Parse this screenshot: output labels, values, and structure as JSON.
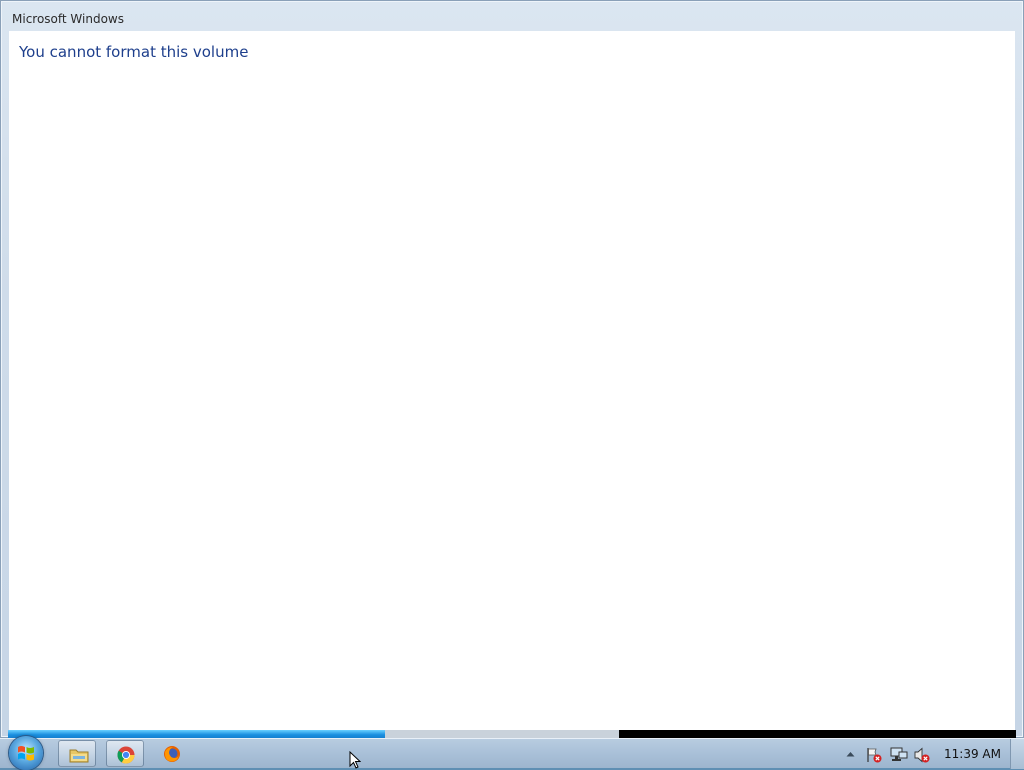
{
  "window": {
    "title": "Microsoft Windows",
    "message": "You cannot format this volume"
  },
  "progress": {
    "fill_fraction": 0.374,
    "track_fraction": 0.606
  },
  "taskbar": {
    "start_icon": "windows-start-orb",
    "pinned": [
      {
        "name": "file-explorer",
        "icon": "folder-icon"
      },
      {
        "name": "google-chrome",
        "icon": "chrome-icon"
      },
      {
        "name": "firefox",
        "icon": "firefox-icon"
      }
    ],
    "tray_icons": [
      "show-hidden-icons-arrow",
      "action-center-flag-icon",
      "network-icon",
      "volume-muted-icon"
    ],
    "clock": "11:39 AM"
  },
  "colors": {
    "heading": "#1e3f8c",
    "progress": "#1a8fe0",
    "tray_error": "#d42020"
  }
}
